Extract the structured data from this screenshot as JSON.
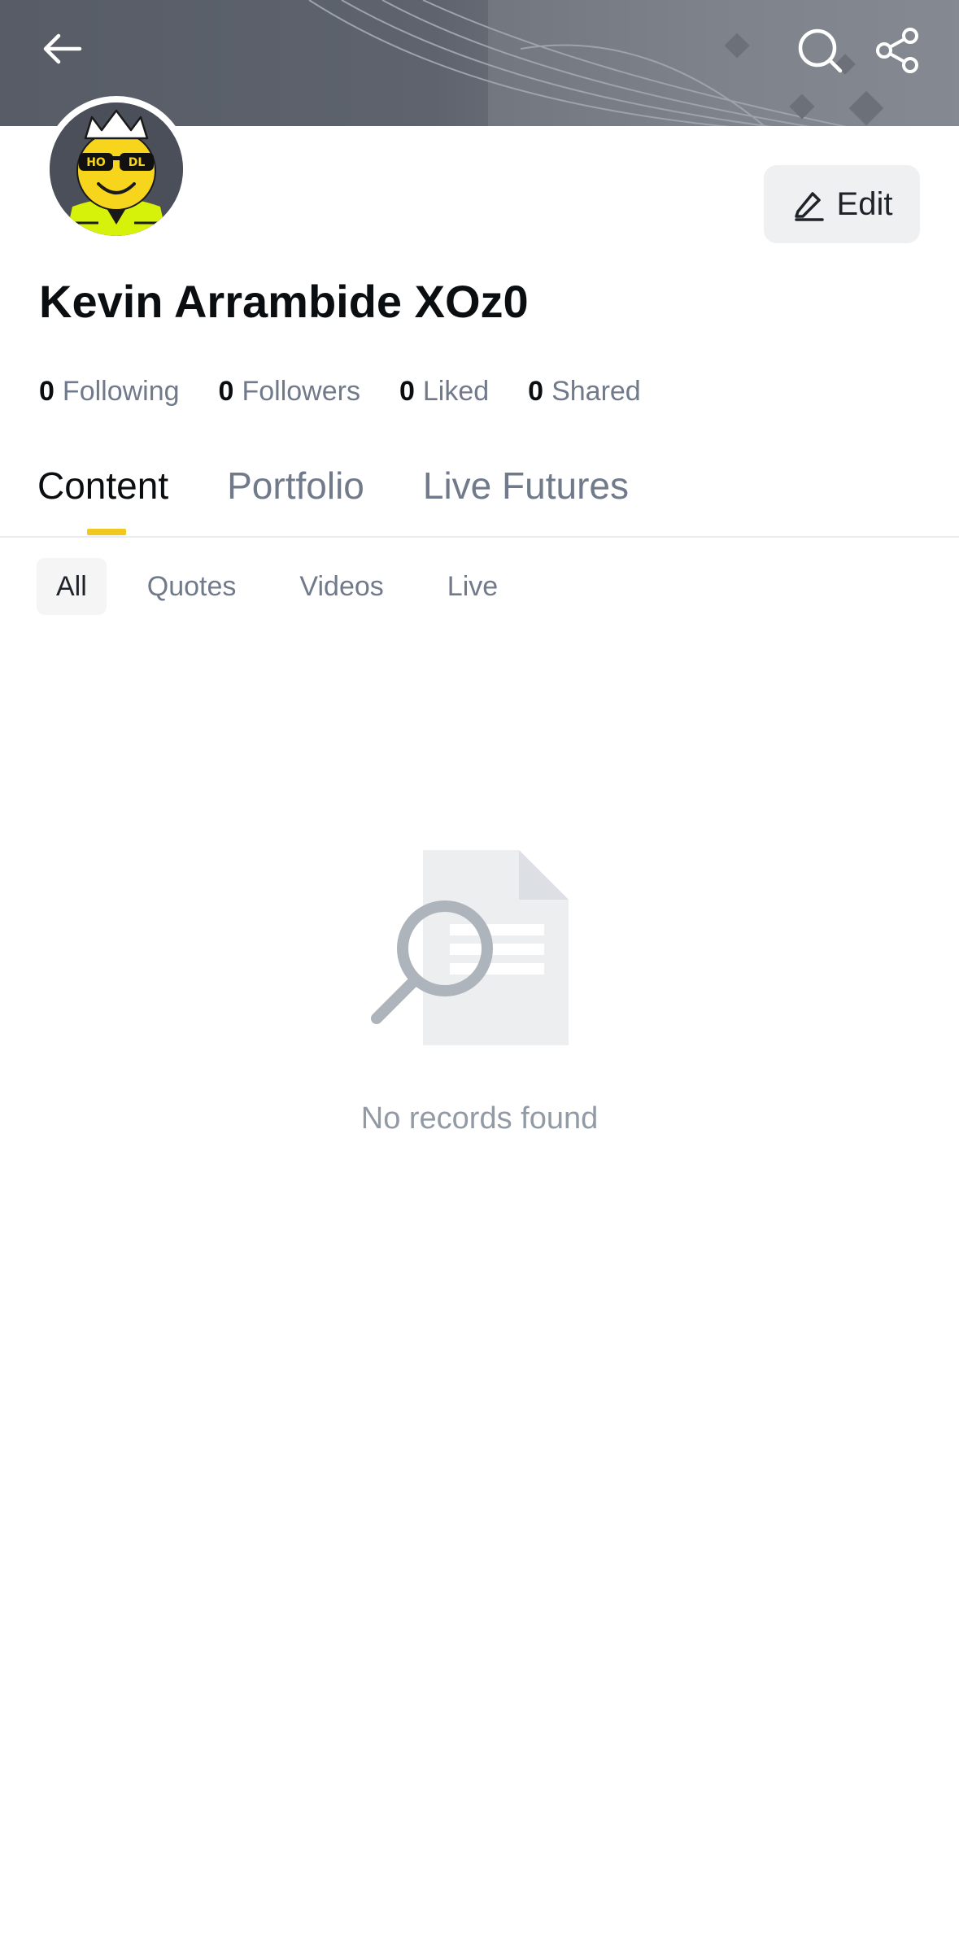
{
  "header": {
    "back_icon": "arrow-left-icon",
    "search_icon": "search-icon",
    "share_icon": "share-icon"
  },
  "profile": {
    "name": "Kevin Arrambide XOz0",
    "avatar_icon": "hodl-smiley-avatar",
    "edit_label": "Edit"
  },
  "stats": [
    {
      "value": "0",
      "label": "Following"
    },
    {
      "value": "0",
      "label": "Followers"
    },
    {
      "value": "0",
      "label": "Liked"
    },
    {
      "value": "0",
      "label": "Shared"
    }
  ],
  "tabs": [
    {
      "label": "Content",
      "active": true
    },
    {
      "label": "Portfolio",
      "active": false
    },
    {
      "label": "Live Futures",
      "active": false
    }
  ],
  "filters": [
    {
      "label": "All",
      "active": true
    },
    {
      "label": "Quotes",
      "active": false
    },
    {
      "label": "Videos",
      "active": false
    },
    {
      "label": "Live",
      "active": false
    }
  ],
  "empty_state": {
    "icon": "document-search-icon",
    "message": "No records found"
  },
  "colors": {
    "accent": "#F0C81E",
    "text_primary": "#0B0E11",
    "text_secondary": "#707A8A"
  }
}
